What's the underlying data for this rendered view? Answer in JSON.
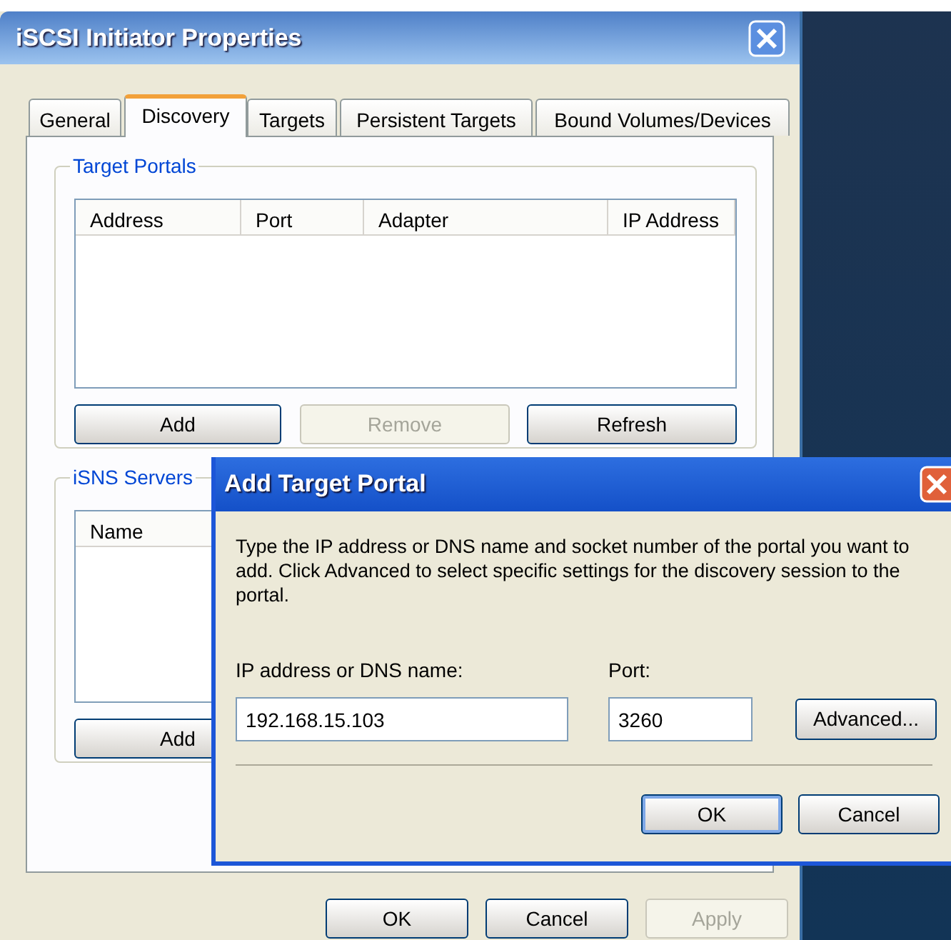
{
  "window": {
    "title": "iSCSI Initiator Properties"
  },
  "tabs": [
    {
      "label": "General",
      "selected": false
    },
    {
      "label": "Discovery",
      "selected": true
    },
    {
      "label": "Targets",
      "selected": false
    },
    {
      "label": "Persistent Targets",
      "selected": false
    },
    {
      "label": "Bound Volumes/Devices",
      "selected": false
    }
  ],
  "target_portals": {
    "title": "Target Portals",
    "columns": [
      "Address",
      "Port",
      "Adapter",
      "IP Address"
    ],
    "buttons": [
      {
        "label": "Add",
        "disabled": false
      },
      {
        "label": "Remove",
        "disabled": true
      },
      {
        "label": "Refresh",
        "disabled": false
      }
    ]
  },
  "isns_servers": {
    "title": "iSNS Servers",
    "columns": [
      "Name"
    ],
    "buttons": [
      {
        "label": "Add",
        "disabled": false
      }
    ]
  },
  "buttons": [
    {
      "label": "OK",
      "disabled": false
    },
    {
      "label": "Cancel",
      "disabled": false
    },
    {
      "label": "Apply",
      "disabled": true
    }
  ],
  "dialog": {
    "title": "Add Target Portal",
    "description": "Type the IP address or DNS name and socket number of the portal you want to add. Click Advanced to select specific settings for the discovery session to the portal.",
    "fields": [
      {
        "label": "IP address or DNS name:",
        "value": "192.168.15.103"
      },
      {
        "label": "Port:",
        "value": "3260"
      }
    ],
    "advanced_button": "Advanced...",
    "buttons": [
      {
        "label": "OK",
        "default": true
      },
      {
        "label": "Cancel",
        "default": false
      }
    ]
  }
}
